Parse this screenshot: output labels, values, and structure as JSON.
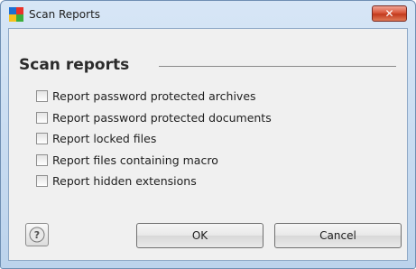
{
  "window": {
    "title": "Scan Reports",
    "close_label": "✕"
  },
  "section": {
    "title": "Scan reports"
  },
  "options": [
    {
      "label": "Report password protected archives",
      "checked": false
    },
    {
      "label": "Report password protected documents",
      "checked": false
    },
    {
      "label": "Report locked files",
      "checked": false
    },
    {
      "label": "Report files containing macro",
      "checked": false
    },
    {
      "label": "Report hidden extensions",
      "checked": false
    }
  ],
  "buttons": {
    "help_icon": "question-mark-icon",
    "ok_label": "OK",
    "cancel_label": "Cancel"
  },
  "colors": {
    "titlebar": "#c9dcf1",
    "client_bg": "#f0f0f0",
    "close_button": "#c94a2d"
  }
}
